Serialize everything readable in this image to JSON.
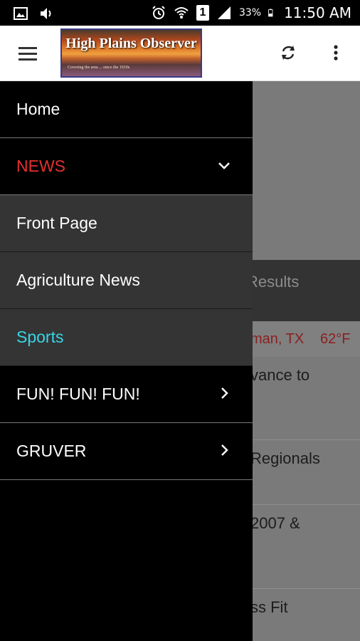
{
  "status_bar": {
    "battery": "33%",
    "time": "11:50 AM",
    "left_icons": [
      "image-icon",
      "volume-icon"
    ],
    "right_icons": [
      "alarm-icon",
      "wifi-icon",
      "sim-icon",
      "signal-icon",
      "battery-icon"
    ],
    "sim_label": "1"
  },
  "app_bar": {
    "logo_title": "High Plains Observer",
    "logo_tagline": "Covering the area ... since the 1910s",
    "icons": [
      "menu-icon",
      "refresh-icon",
      "more-vertical-icon"
    ]
  },
  "drawer": {
    "items": [
      {
        "label": "Home",
        "style": "normal"
      },
      {
        "label": "NEWS",
        "style": "red",
        "icon": "chevron-down-icon"
      },
      {
        "label": "Front Page",
        "style": "sub"
      },
      {
        "label": "Agriculture News",
        "style": "sub"
      },
      {
        "label": "Sports",
        "style": "sub-selected"
      },
      {
        "label": "FUN! FUN! FUN!",
        "style": "normal",
        "icon": "chevron-right-icon"
      },
      {
        "label": "GRUVER",
        "style": "normal",
        "icon": "chevron-right-icon"
      }
    ]
  },
  "background_page": {
    "tab_label": "Results",
    "weather_location": "man, TX",
    "weather_temp": "62°F",
    "stories": [
      "vance to",
      "Regionals",
      "2007 &",
      "ss Fit"
    ]
  },
  "colors": {
    "news_red": "#e53030",
    "selected_cyan": "#37d6e6",
    "drawer_bg": "#000000",
    "submenu_bg": "#343434"
  }
}
